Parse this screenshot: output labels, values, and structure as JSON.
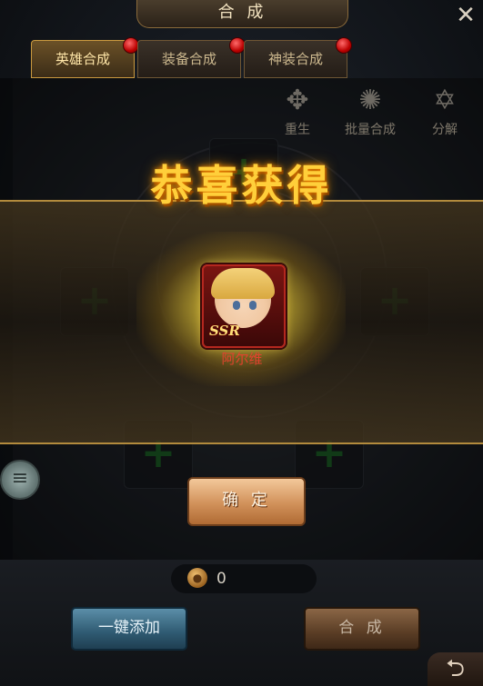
{
  "window": {
    "title": "合 成",
    "close_icon": "✕"
  },
  "tabs": [
    {
      "label": "英雄合成",
      "active": true,
      "badge": true
    },
    {
      "label": "装备合成",
      "active": false,
      "badge": true
    },
    {
      "label": "神装合成",
      "active": false,
      "badge": true
    }
  ],
  "actions": [
    {
      "label": "重生",
      "icon": "rebirth-icon",
      "glyph": "✥"
    },
    {
      "label": "批量合成",
      "icon": "batch-synthesis-icon",
      "glyph": "✺"
    },
    {
      "label": "分解",
      "icon": "decompose-icon",
      "glyph": "✡"
    }
  ],
  "reward": {
    "headline": "恭喜获得",
    "hero_name": "阿尔维",
    "rarity": "SSR",
    "confirm_label": "确 定"
  },
  "footer": {
    "coin_value": "0",
    "auto_add_label": "一键添加",
    "synthesize_label": "合 成"
  },
  "colors": {
    "headline": "#ffcf3a",
    "hero_name": "#e2422e",
    "plus": "#1f6b2a",
    "auto_btn": "#2f5a72",
    "confirm_btn": "#d1915a"
  }
}
